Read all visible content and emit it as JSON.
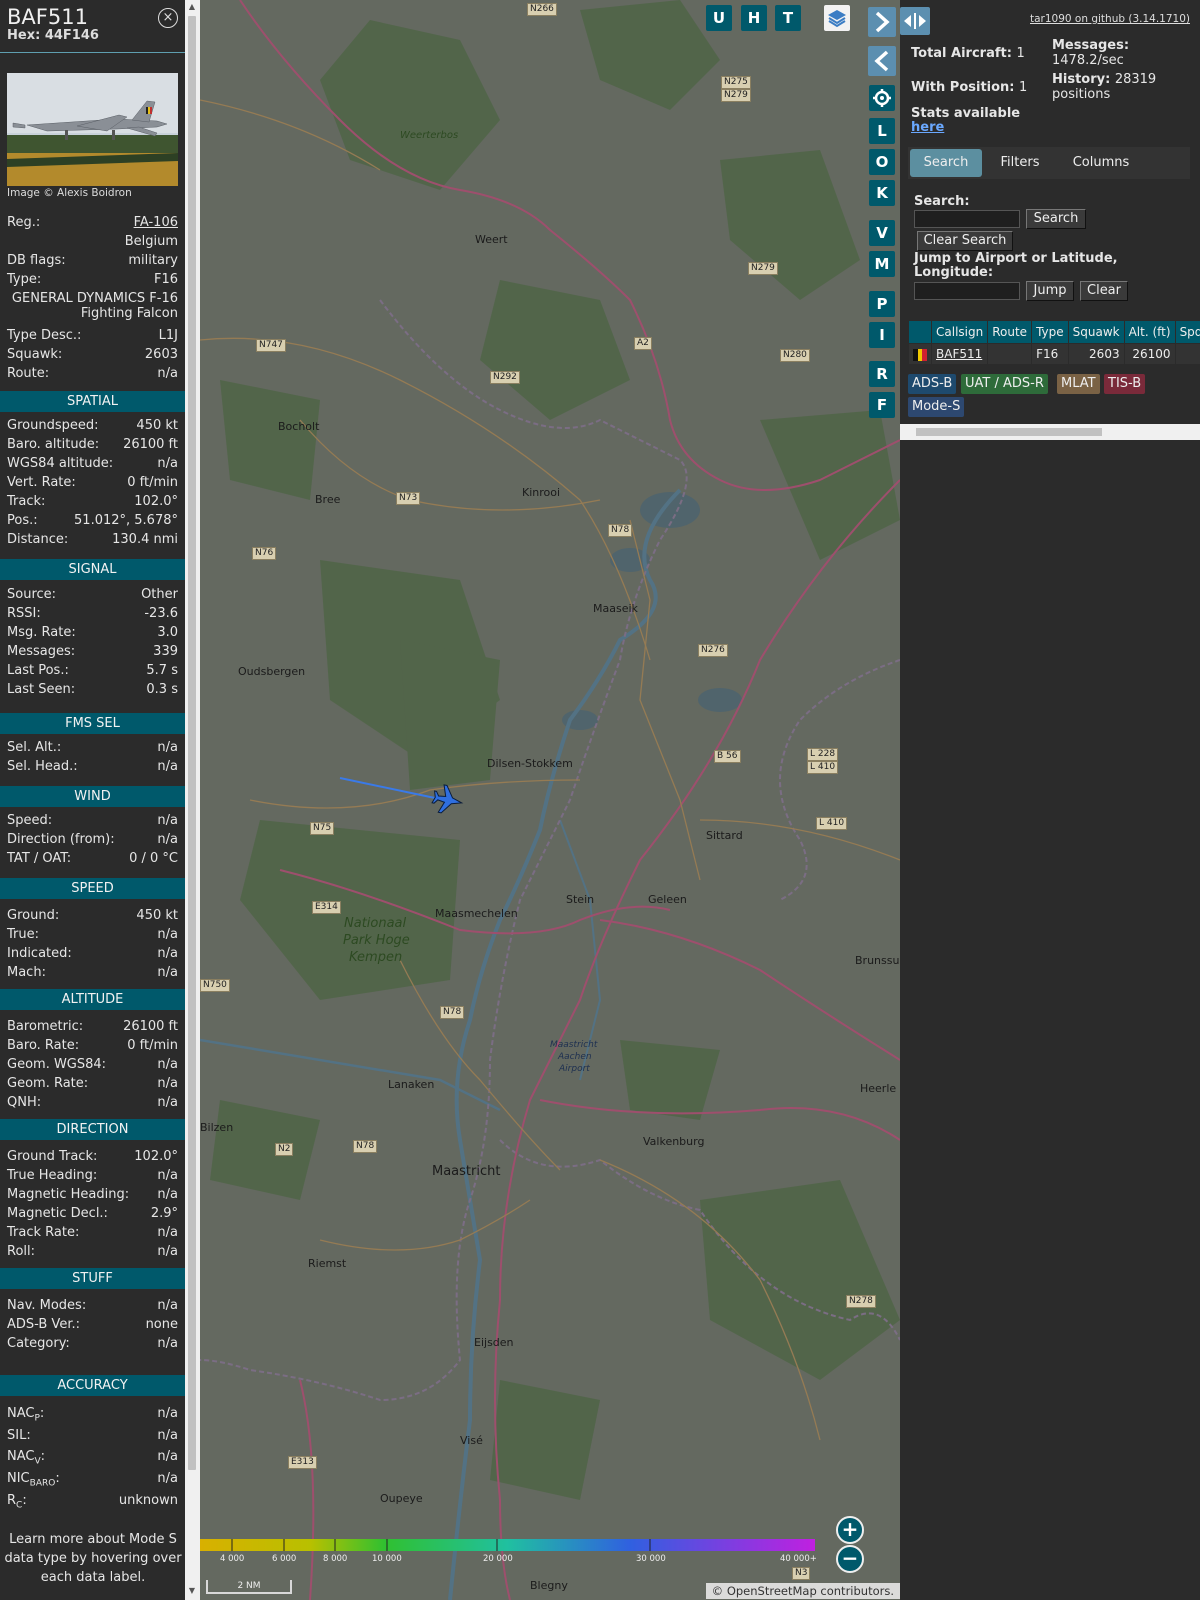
{
  "info": {
    "callsign": "BAF511",
    "hex_label": "Hex:",
    "hex": "44F146",
    "close_glyph": "×",
    "image_credit": "Image © Alexis Boidron",
    "rows_top": [
      {
        "k": "Reg.:",
        "v": "FA-106"
      },
      {
        "k": "",
        "v": "Belgium"
      },
      {
        "k": "DB flags:",
        "v": "military"
      },
      {
        "k": "Type:",
        "v": "F16"
      }
    ],
    "type_full_1": "GENERAL DYNAMICS F-16",
    "type_full_2": "Fighting Falcon",
    "rows_type": [
      {
        "k": "Type Desc.:",
        "v": "L1J"
      },
      {
        "k": "Squawk:",
        "v": "2603"
      },
      {
        "k": "Route:",
        "v": "n/a"
      }
    ],
    "sections": {
      "spatial": "SPATIAL",
      "signal": "SIGNAL",
      "fms": "FMS SEL",
      "wind": "WIND",
      "speed": "SPEED",
      "altitude": "ALTITUDE",
      "direction": "DIRECTION",
      "stuff": "STUFF",
      "accuracy": "ACCURACY"
    },
    "spatial": [
      {
        "k": "Groundspeed:",
        "v": "450 kt"
      },
      {
        "k": "Baro. altitude:",
        "v": "26100 ft"
      },
      {
        "k": "WGS84 altitude:",
        "v": "n/a"
      },
      {
        "k": "Vert. Rate:",
        "v": "0 ft/min"
      },
      {
        "k": "Track:",
        "v": "102.0°"
      },
      {
        "k": "Pos.:",
        "v": "51.012°, 5.678°"
      },
      {
        "k": "Distance:",
        "v": "130.4 nmi"
      }
    ],
    "signal": [
      {
        "k": "Source:",
        "v": "Other"
      },
      {
        "k": "RSSI:",
        "v": "-23.6"
      },
      {
        "k": "Msg. Rate:",
        "v": "3.0"
      },
      {
        "k": "Messages:",
        "v": "339"
      },
      {
        "k": "Last Pos.:",
        "v": "5.7 s"
      },
      {
        "k": "Last Seen:",
        "v": "0.3 s"
      }
    ],
    "fms": [
      {
        "k": "Sel. Alt.:",
        "v": "n/a"
      },
      {
        "k": "Sel. Head.:",
        "v": "n/a"
      }
    ],
    "wind": [
      {
        "k": "Speed:",
        "v": "n/a"
      },
      {
        "k": "Direction (from):",
        "v": "n/a"
      },
      {
        "k": "TAT / OAT:",
        "v": "0 / 0 °C"
      }
    ],
    "speed": [
      {
        "k": "Ground:",
        "v": "450 kt"
      },
      {
        "k": "True:",
        "v": "n/a"
      },
      {
        "k": "Indicated:",
        "v": "n/a"
      },
      {
        "k": "Mach:",
        "v": "n/a"
      }
    ],
    "altitude": [
      {
        "k": "Barometric:",
        "v": "26100 ft"
      },
      {
        "k": "Baro. Rate:",
        "v": "0 ft/min"
      },
      {
        "k": "Geom. WGS84:",
        "v": "n/a"
      },
      {
        "k": "Geom. Rate:",
        "v": "n/a"
      },
      {
        "k": "QNH:",
        "v": "n/a"
      }
    ],
    "direction": [
      {
        "k": "Ground Track:",
        "v": "102.0°"
      },
      {
        "k": "True Heading:",
        "v": "n/a"
      },
      {
        "k": "Magnetic Heading:",
        "v": "n/a"
      },
      {
        "k": "Magnetic Decl.:",
        "v": "2.9°"
      },
      {
        "k": "Track Rate:",
        "v": "n/a"
      },
      {
        "k": "Roll:",
        "v": "n/a"
      }
    ],
    "stuff": [
      {
        "k": "Nav. Modes:",
        "v": "n/a"
      },
      {
        "k": "ADS-B Ver.:",
        "v": "none"
      },
      {
        "k": "Category:",
        "v": "n/a"
      }
    ],
    "accuracy": [
      {
        "k": "NAC",
        "sub": "P",
        "suffix": ":",
        "v": "n/a"
      },
      {
        "k": "SIL:",
        "sub": "",
        "suffix": "",
        "v": "n/a"
      },
      {
        "k": "NAC",
        "sub": "V",
        "suffix": ":",
        "v": "n/a"
      },
      {
        "k": "NIC",
        "sub": "BARO",
        "suffix": ":",
        "v": "n/a"
      },
      {
        "k": "R",
        "sub": "C",
        "suffix": ":",
        "v": "unknown"
      }
    ],
    "learn_more": "Learn more about Mode S data type by hovering over each data label."
  },
  "map": {
    "toolbar_top": [
      "U",
      "H",
      "T"
    ],
    "toolbar_side": [
      "L",
      "O",
      "K",
      "V",
      "M",
      "P",
      "I",
      "R",
      "F"
    ],
    "places": [
      {
        "id": "weert",
        "name": "Weert"
      },
      {
        "id": "weerterbos",
        "name": "Weerterbos"
      },
      {
        "id": "bocholt",
        "name": "Bocholt"
      },
      {
        "id": "bree",
        "name": "Bree"
      },
      {
        "id": "kinrooi",
        "name": "Kinrooi"
      },
      {
        "id": "maaseik",
        "name": "Maaseik"
      },
      {
        "id": "oudsbergen",
        "name": "Oudsbergen"
      },
      {
        "id": "dilsen",
        "name": "Dilsen-Stokkem"
      },
      {
        "id": "sittard",
        "name": "Sittard"
      },
      {
        "id": "stein",
        "name": "Stein"
      },
      {
        "id": "geleen",
        "name": "Geleen"
      },
      {
        "id": "maasmechelen",
        "name": "Maasmechelen"
      },
      {
        "id": "lanaken",
        "name": "Lanaken"
      },
      {
        "id": "bilzen",
        "name": "Bilzen"
      },
      {
        "id": "maastricht",
        "name": "Maastricht"
      },
      {
        "id": "valkenburg",
        "name": "Valkenburg"
      },
      {
        "id": "riemst",
        "name": "Riemst"
      },
      {
        "id": "eijsden",
        "name": "Eijsden"
      },
      {
        "id": "vise",
        "name": "Visé"
      },
      {
        "id": "oupeye",
        "name": "Oupeye"
      },
      {
        "id": "blegny",
        "name": "Blegny"
      },
      {
        "id": "brunssum",
        "name": "Brunssum"
      },
      {
        "id": "heerlen",
        "name": "Heerle"
      },
      {
        "id": "nphk1",
        "name": "Nationaal"
      },
      {
        "id": "nphk2",
        "name": "Park Hoge"
      },
      {
        "id": "nphk3",
        "name": "Kempen"
      },
      {
        "id": "airport1",
        "name": "Maastricht"
      },
      {
        "id": "airport2",
        "name": "Aachen"
      },
      {
        "id": "airport3",
        "name": "Airport"
      }
    ],
    "roads": [
      "N266",
      "N275",
      "N279",
      "N279",
      "N747",
      "N292",
      "A2",
      "N280",
      "N73",
      "N78",
      "N76",
      "N276",
      "B 56",
      "L 228",
      "L 410",
      "L 410",
      "N75",
      "E314",
      "N750",
      "N78",
      "N2",
      "N78",
      "E313",
      "N278",
      "N3"
    ],
    "altitude_scale": [
      "4 000",
      "6 000",
      "8 000",
      "10 000",
      "20 000",
      "30 000",
      "40 000+"
    ],
    "scale_label": "2 NM",
    "attribution": "© OpenStreetMap contributors.",
    "aircraft_color": "#2f6fe0",
    "track_color": "#3a7ae8"
  },
  "right": {
    "github": "tar1090 on github (3.14.1710)",
    "total_label": "Total Aircraft:",
    "total_val": "1",
    "withpos_label": "With Position:",
    "withpos_val": "1",
    "messages_label": "Messages:",
    "messages_val": "1478.2/sec",
    "history_label": "History:",
    "history_val": "28319",
    "history_unit": "positions",
    "stats_label": "Stats available",
    "stats_link": "here",
    "tabs": [
      "Search",
      "Filters",
      "Columns"
    ],
    "search_label": "Search:",
    "search_btn": "Search",
    "clear_search_btn": "Clear Search",
    "jump_label_1": "Jump to Airport or Latitude,",
    "jump_label_2": "Longitude:",
    "jump_btn": "Jump",
    "clear_btn": "Clear",
    "table": {
      "headers": [
        "",
        "Callsign",
        "Route",
        "Type",
        "Squawk",
        "Alt. (ft)",
        "Spd."
      ],
      "row": {
        "callsign": "BAF511",
        "route": "",
        "type": "F16",
        "squawk": "2603",
        "alt": "26100",
        "spd": ""
      }
    },
    "sources": [
      {
        "label": "ADS-B",
        "color": "#1e4a6e"
      },
      {
        "label": "UAT / ADS-R",
        "color": "#2e6b3a"
      },
      {
        "label": "MLAT",
        "color": "#7a6245"
      },
      {
        "label": "TIS-B",
        "color": "#7a2a3a"
      },
      {
        "label": "Mode-S",
        "color": "#2d4870"
      }
    ]
  }
}
